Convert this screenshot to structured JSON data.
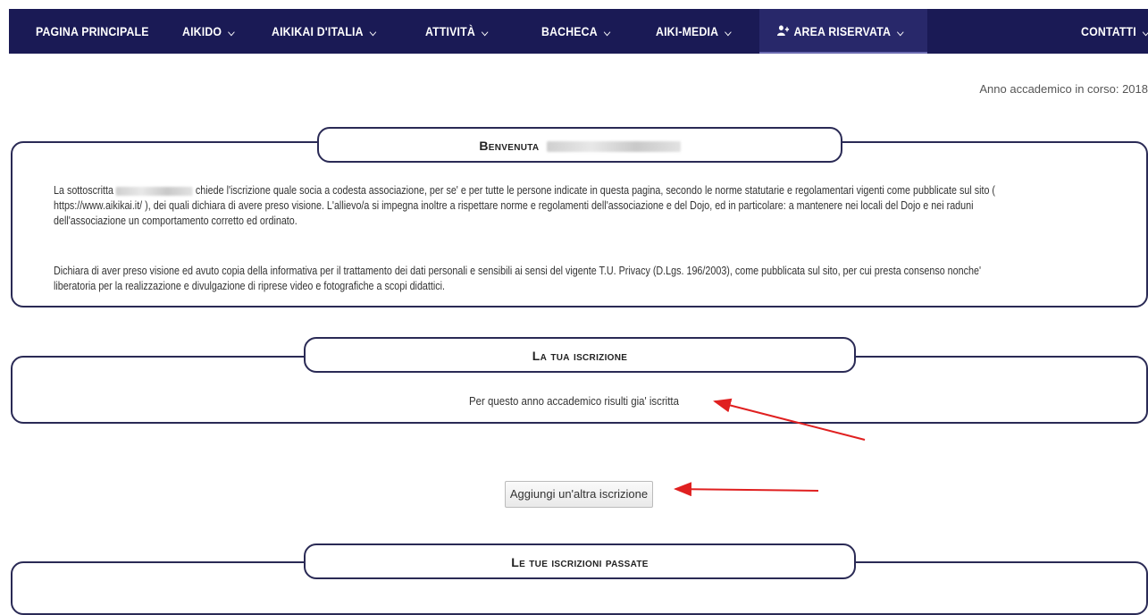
{
  "nav": {
    "items": [
      {
        "label": "PAGINA PRINCIPALE",
        "chevron": false
      },
      {
        "label": "AIKIDO",
        "chevron": true
      },
      {
        "label": "AIKIKAI D'ITALIA",
        "chevron": true
      },
      {
        "label": "ATTIVITÀ",
        "chevron": true
      },
      {
        "label": "BACHECA",
        "chevron": true
      },
      {
        "label": "AIKI-MEDIA",
        "chevron": true
      },
      {
        "label": "AREA RISERVATA",
        "chevron": true,
        "active": true,
        "icon": "user-plus-icon"
      },
      {
        "label": "CONTATTI",
        "chevron": true
      }
    ]
  },
  "anno": "Anno accademico in corso: 2018",
  "welcome": {
    "title": "Benvenuta",
    "p1_prefix": "La sottoscritta",
    "p1_line1": "chiede l'iscrizione quale socia a codesta associazione, per se' e per tutte le persone indicate in questa pagina, secondo le norme statutarie e regolamentari vigenti come pubblicate sul sito (",
    "p1_line2": "https://www.aikikai.it/ ), dei quali dichiara di avere preso visione. L'allievo/a si impegna inoltre a rispettare norme e regolamenti dell'associazione e del Dojo, ed in particolare: a mantenere nei locali del Dojo e nei raduni",
    "p1_line3": "dell'associazione un comportamento corretto ed ordinato.",
    "p2_line1": "Dichiara di aver preso visione ed avuto copia della informativa per il trattamento dei dati personali e sensibili ai sensi del vigente T.U. Privacy (D.Lgs. 196/2003), come pubblicata sul sito, per cui presta consenso nonche'",
    "p2_line2": "liberatoria per la realizzazione e divulgazione di riprese video e fotografiche a scopi didattici."
  },
  "iscrizione": {
    "title": "La tua iscrizione",
    "message": "Per questo anno accademico risulti gia' iscritta"
  },
  "add_button": "Aggiungi un'altra iscrizione",
  "passate": {
    "title": "Le tue iscrizioni passate"
  },
  "colors": {
    "nav_bg": "#1a1a55",
    "border": "#2a2a55",
    "arrow": "#e02020"
  }
}
